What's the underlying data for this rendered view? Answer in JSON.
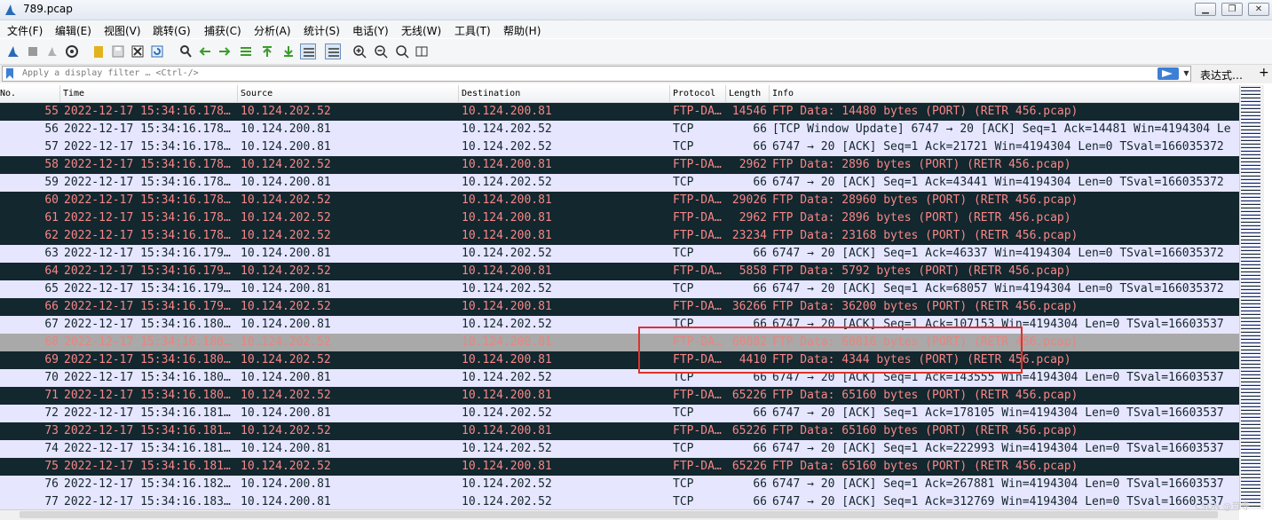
{
  "window": {
    "title": "789.pcap"
  },
  "menu": [
    "文件(F)",
    "编辑(E)",
    "视图(V)",
    "跳转(G)",
    "捕获(C)",
    "分析(A)",
    "统计(S)",
    "电话(Y)",
    "无线(W)",
    "工具(T)",
    "帮助(H)"
  ],
  "filter": {
    "placeholder": "Apply a display filter … <Ctrl-/>",
    "expression_label": "表达式…",
    "plus": "+"
  },
  "columns": [
    "No.",
    "Time",
    "Source",
    "Destination",
    "Protocol",
    "Length",
    "Info"
  ],
  "colors": {
    "ftp_data_bg": "#12272e",
    "ftp_data_fg": "#f78787",
    "tcp_bg": "#e7e6ff",
    "tcp_fg": "#12272e",
    "selected_bg": "#a9a9a9",
    "selected_fg": "#e8857e",
    "highlight": "#e0312b"
  },
  "packets": [
    {
      "no": "55",
      "time": "2022-12-17 15:34:16.178…",
      "src": "10.124.202.52",
      "dst": "10.124.200.81",
      "proto": "FTP-DA…",
      "len": "14546",
      "info": "FTP Data: 14480 bytes (PORT) (RETR 456.pcap)",
      "kind": "ftp"
    },
    {
      "no": "56",
      "time": "2022-12-17 15:34:16.178…",
      "src": "10.124.200.81",
      "dst": "10.124.202.52",
      "proto": "TCP",
      "len": "66",
      "info": "[TCP Window Update] 6747 → 20 [ACK] Seq=1 Ack=14481 Win=4194304 Le",
      "kind": "tcp"
    },
    {
      "no": "57",
      "time": "2022-12-17 15:34:16.178…",
      "src": "10.124.200.81",
      "dst": "10.124.202.52",
      "proto": "TCP",
      "len": "66",
      "info": "6747 → 20 [ACK] Seq=1 Ack=21721 Win=4194304 Len=0 TSval=166035372",
      "kind": "tcp"
    },
    {
      "no": "58",
      "time": "2022-12-17 15:34:16.178…",
      "src": "10.124.202.52",
      "dst": "10.124.200.81",
      "proto": "FTP-DA…",
      "len": "2962",
      "info": "FTP Data: 2896 bytes (PORT) (RETR 456.pcap)",
      "kind": "ftp"
    },
    {
      "no": "59",
      "time": "2022-12-17 15:34:16.178…",
      "src": "10.124.200.81",
      "dst": "10.124.202.52",
      "proto": "TCP",
      "len": "66",
      "info": "6747 → 20 [ACK] Seq=1 Ack=43441 Win=4194304 Len=0 TSval=166035372",
      "kind": "tcp"
    },
    {
      "no": "60",
      "time": "2022-12-17 15:34:16.178…",
      "src": "10.124.202.52",
      "dst": "10.124.200.81",
      "proto": "FTP-DA…",
      "len": "29026",
      "info": "FTP Data: 28960 bytes (PORT) (RETR 456.pcap)",
      "kind": "ftp"
    },
    {
      "no": "61",
      "time": "2022-12-17 15:34:16.178…",
      "src": "10.124.202.52",
      "dst": "10.124.200.81",
      "proto": "FTP-DA…",
      "len": "2962",
      "info": "FTP Data: 2896 bytes (PORT) (RETR 456.pcap)",
      "kind": "ftp"
    },
    {
      "no": "62",
      "time": "2022-12-17 15:34:16.178…",
      "src": "10.124.202.52",
      "dst": "10.124.200.81",
      "proto": "FTP-DA…",
      "len": "23234",
      "info": "FTP Data: 23168 bytes (PORT) (RETR 456.pcap)",
      "kind": "ftp"
    },
    {
      "no": "63",
      "time": "2022-12-17 15:34:16.179…",
      "src": "10.124.200.81",
      "dst": "10.124.202.52",
      "proto": "TCP",
      "len": "66",
      "info": "6747 → 20 [ACK] Seq=1 Ack=46337 Win=4194304 Len=0 TSval=166035372",
      "kind": "tcp"
    },
    {
      "no": "64",
      "time": "2022-12-17 15:34:16.179…",
      "src": "10.124.202.52",
      "dst": "10.124.200.81",
      "proto": "FTP-DA…",
      "len": "5858",
      "info": "FTP Data: 5792 bytes (PORT) (RETR 456.pcap)",
      "kind": "ftp"
    },
    {
      "no": "65",
      "time": "2022-12-17 15:34:16.179…",
      "src": "10.124.200.81",
      "dst": "10.124.202.52",
      "proto": "TCP",
      "len": "66",
      "info": "6747 → 20 [ACK] Seq=1 Ack=68057 Win=4194304 Len=0 TSval=166035372",
      "kind": "tcp"
    },
    {
      "no": "66",
      "time": "2022-12-17 15:34:16.179…",
      "src": "10.124.202.52",
      "dst": "10.124.200.81",
      "proto": "FTP-DA…",
      "len": "36266",
      "info": "FTP Data: 36200 bytes (PORT) (RETR 456.pcap)",
      "kind": "ftp"
    },
    {
      "no": "67",
      "time": "2022-12-17 15:34:16.180…",
      "src": "10.124.200.81",
      "dst": "10.124.202.52",
      "proto": "TCP",
      "len": "66",
      "info": "6747 → 20 [ACK] Seq=1 Ack=107153 Win=4194304 Len=0 TSval=16603537",
      "kind": "tcp"
    },
    {
      "no": "68",
      "time": "2022-12-17 15:34:16.180…",
      "src": "10.124.202.52",
      "dst": "10.124.200.81",
      "proto": "FTP-DA…",
      "len": "60882",
      "info": "FTP Data: 60816 bytes (PORT) (RETR 456.pcap)",
      "kind": "selected"
    },
    {
      "no": "69",
      "time": "2022-12-17 15:34:16.180…",
      "src": "10.124.202.52",
      "dst": "10.124.200.81",
      "proto": "FTP-DA…",
      "len": "4410",
      "info": "FTP Data: 4344 bytes (PORT) (RETR 456.pcap)",
      "kind": "ftp"
    },
    {
      "no": "70",
      "time": "2022-12-17 15:34:16.180…",
      "src": "10.124.200.81",
      "dst": "10.124.202.52",
      "proto": "TCP",
      "len": "66",
      "info": "6747 → 20 [ACK] Seq=1 Ack=143555 Win=4194304 Len=0 TSval=16603537",
      "kind": "tcp"
    },
    {
      "no": "71",
      "time": "2022-12-17 15:34:16.180…",
      "src": "10.124.202.52",
      "dst": "10.124.200.81",
      "proto": "FTP-DA…",
      "len": "65226",
      "info": "FTP Data: 65160 bytes (PORT) (RETR 456.pcap)",
      "kind": "ftp"
    },
    {
      "no": "72",
      "time": "2022-12-17 15:34:16.181…",
      "src": "10.124.200.81",
      "dst": "10.124.202.52",
      "proto": "TCP",
      "len": "66",
      "info": "6747 → 20 [ACK] Seq=1 Ack=178105 Win=4194304 Len=0 TSval=16603537",
      "kind": "tcp"
    },
    {
      "no": "73",
      "time": "2022-12-17 15:34:16.181…",
      "src": "10.124.202.52",
      "dst": "10.124.200.81",
      "proto": "FTP-DA…",
      "len": "65226",
      "info": "FTP Data: 65160 bytes (PORT) (RETR 456.pcap)",
      "kind": "ftp"
    },
    {
      "no": "74",
      "time": "2022-12-17 15:34:16.181…",
      "src": "10.124.200.81",
      "dst": "10.124.202.52",
      "proto": "TCP",
      "len": "66",
      "info": "6747 → 20 [ACK] Seq=1 Ack=222993 Win=4194304 Len=0 TSval=16603537",
      "kind": "tcp"
    },
    {
      "no": "75",
      "time": "2022-12-17 15:34:16.181…",
      "src": "10.124.202.52",
      "dst": "10.124.200.81",
      "proto": "FTP-DA…",
      "len": "65226",
      "info": "FTP Data: 65160 bytes (PORT) (RETR 456.pcap)",
      "kind": "ftp"
    },
    {
      "no": "76",
      "time": "2022-12-17 15:34:16.182…",
      "src": "10.124.200.81",
      "dst": "10.124.202.52",
      "proto": "TCP",
      "len": "66",
      "info": "6747 → 20 [ACK] Seq=1 Ack=267881 Win=4194304 Len=0 TSval=16603537",
      "kind": "tcp"
    },
    {
      "no": "77",
      "time": "2022-12-17 15:34:16.183…",
      "src": "10.124.200.81",
      "dst": "10.124.202.52",
      "proto": "TCP",
      "len": "66",
      "info": "6747 → 20 [ACK] Seq=1 Ack=312769 Win=4194304 Len=0 TSval=16603537",
      "kind": "tcp"
    }
  ],
  "watermark": "CSDN @苛寺"
}
